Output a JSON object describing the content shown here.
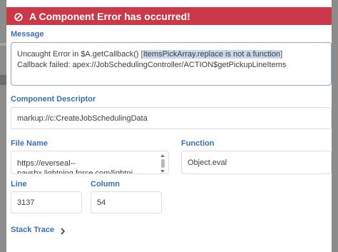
{
  "header": {
    "title": "A Component Error has occurred!",
    "icon": "circle-slash-icon"
  },
  "message": {
    "label": "Message",
    "line1_pre": "Uncaught Error in $A.getCallback() [",
    "line1_hl": "ItemsPickArray.replace is not a function",
    "line1_post": "]",
    "line2": "Callback failed: apex://JobSchedulingController/ACTION$getPickupLineItems"
  },
  "descriptor": {
    "label": "Component Descriptor",
    "value": "markup://c:CreateJobSchedulingData"
  },
  "file": {
    "label": "File Name",
    "line1": "https://everseal--",
    "line2": "paysbx.lightning.force.com/lightni"
  },
  "function": {
    "label": "Function",
    "value": "Object.eval"
  },
  "line": {
    "label": "Line",
    "value": "3137"
  },
  "column": {
    "label": "Column",
    "value": "54"
  },
  "stack": {
    "label": "Stack Trace"
  },
  "colors": {
    "error": "#c9394a",
    "label": "#3c6fae",
    "highlight": "#c7d7ec"
  }
}
